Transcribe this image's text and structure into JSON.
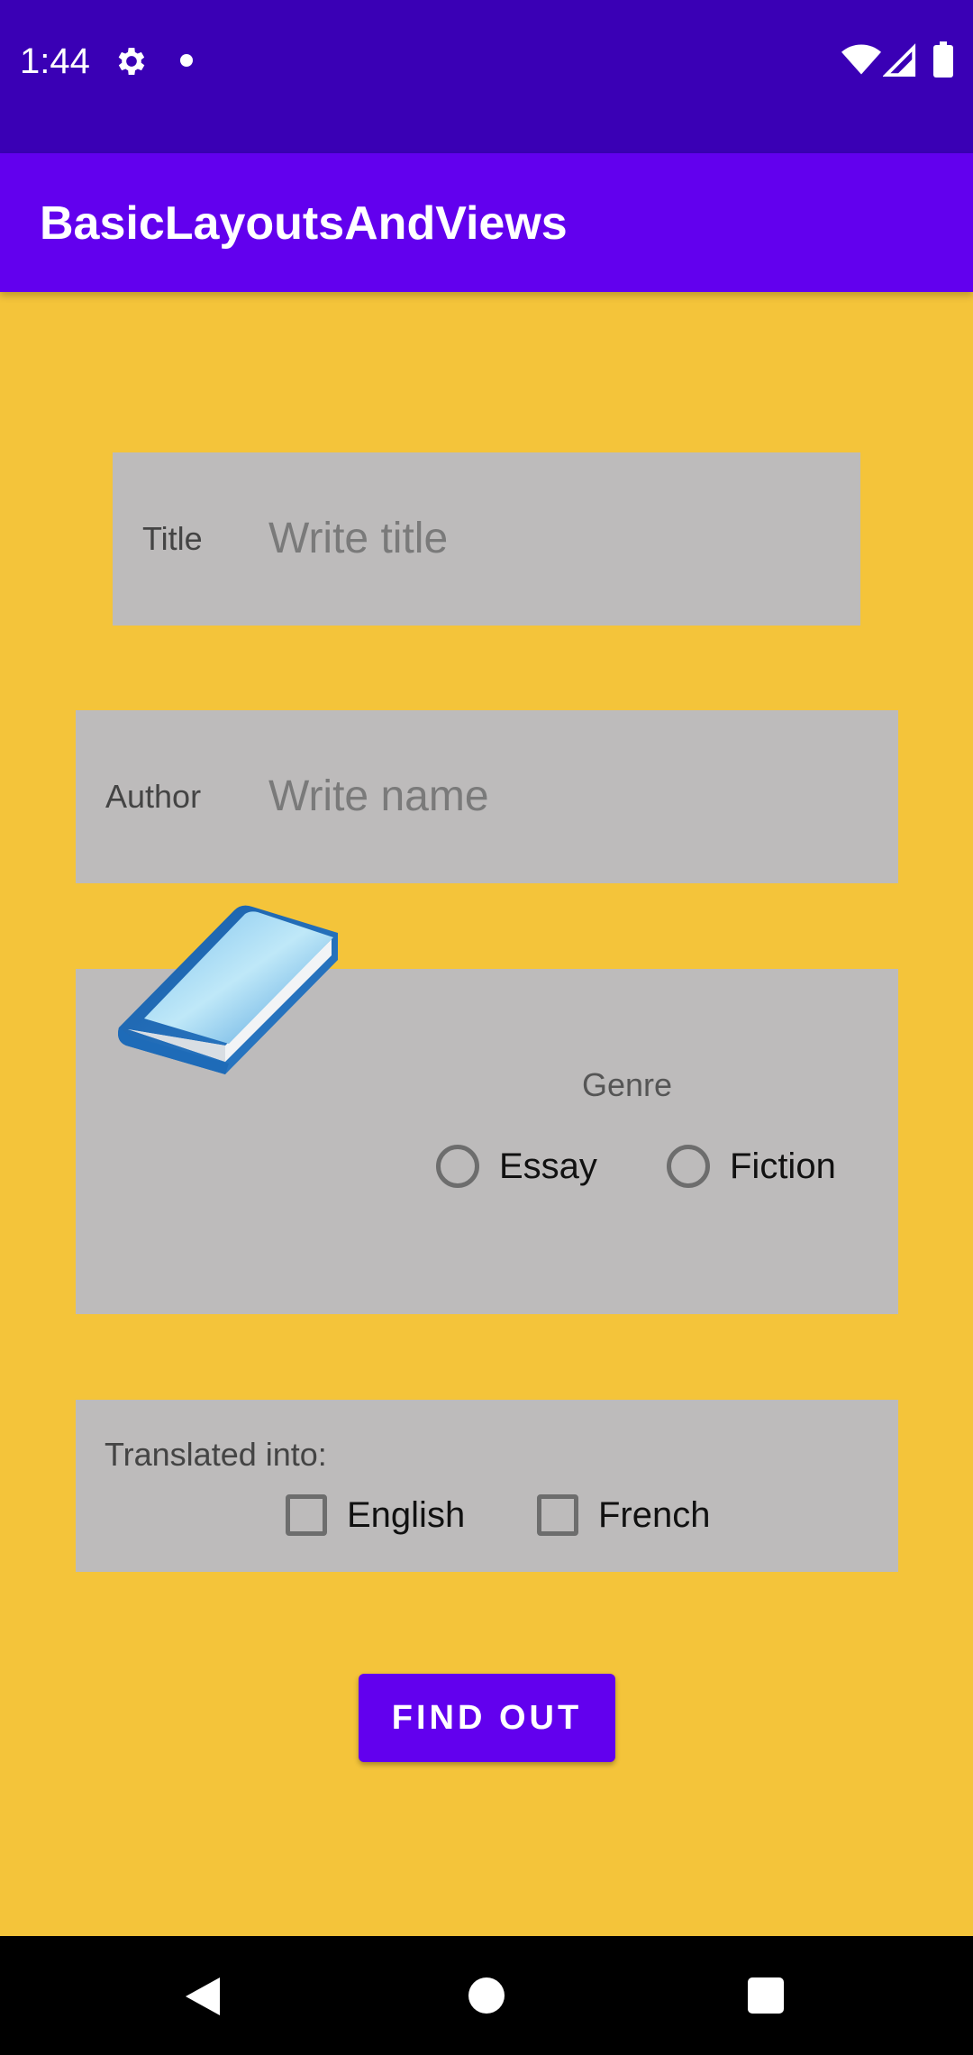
{
  "status_bar": {
    "time": "1:44",
    "icons": [
      "gear-icon",
      "notification-dot-icon",
      "wifi-icon",
      "signal-icon",
      "battery-icon"
    ]
  },
  "app_bar": {
    "title": "BasicLayoutsAndViews",
    "color": "#6200EE"
  },
  "form": {
    "background_color": "#F4C43A",
    "panel_color": "#BDBBBB",
    "title_field": {
      "label": "Title",
      "value": "",
      "placeholder": "Write title"
    },
    "author_field": {
      "label": "Author",
      "value": "",
      "placeholder": "Write name"
    },
    "book_image": "book-icon",
    "genre": {
      "label": "Genre",
      "options": [
        {
          "label": "Essay",
          "selected": false
        },
        {
          "label": "Fiction",
          "selected": false
        }
      ]
    },
    "translated": {
      "label": "Translated into:",
      "options": [
        {
          "label": "English",
          "checked": false
        },
        {
          "label": "French",
          "checked": false
        }
      ]
    },
    "find_button": {
      "label": "FIND OUT"
    }
  },
  "nav_bar": {
    "icons": [
      "back-icon",
      "home-icon",
      "recents-icon"
    ]
  }
}
